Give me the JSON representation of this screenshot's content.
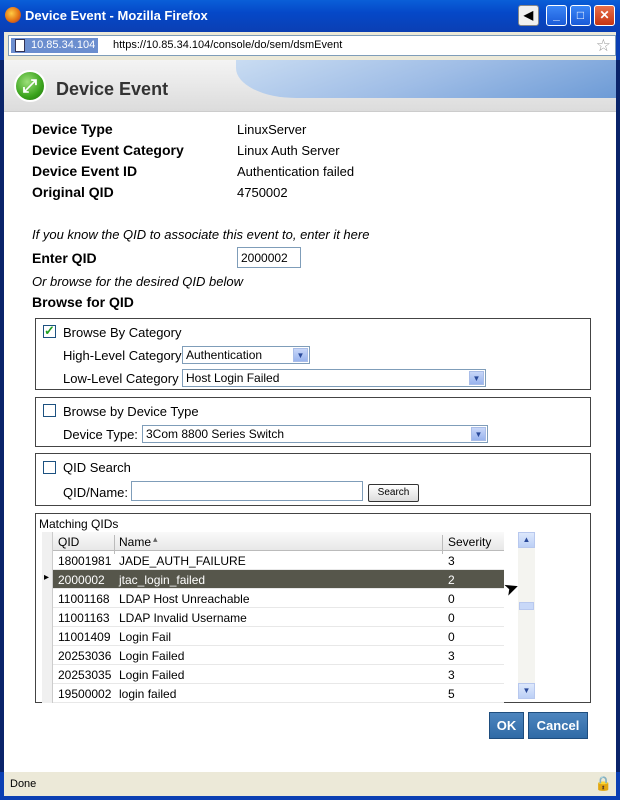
{
  "window": {
    "title": "Device Event - Mozilla Firefox",
    "buttons": {
      "back": "◀",
      "minimize": "_",
      "maximize": "□",
      "close": "✕"
    }
  },
  "urlbar": {
    "host": "10.85.34.104",
    "url": "https://10.85.34.104/console/do/sem/dsmEvent",
    "bookmark_icon": "star-icon"
  },
  "header": {
    "title": "Device Event",
    "icon": "event-map-icon"
  },
  "details": [
    {
      "label": "Device Type",
      "value": "LinuxServer"
    },
    {
      "label": "Device Event Category",
      "value": "Linux Auth Server"
    },
    {
      "label": "Device Event ID",
      "value": "Authentication failed"
    },
    {
      "label": "Original QID",
      "value": "4750002"
    }
  ],
  "qid_entry": {
    "hint": "If you know the QID to associate this event to, enter it here",
    "label": "Enter QID",
    "value": "2000002",
    "browse_hint": "Or browse for the desired QID below",
    "browse_title": "Browse for QID"
  },
  "category_box": {
    "label": "Browse By Category",
    "checked": true,
    "high_label": "High-Level Category",
    "high_value": "Authentication",
    "low_label": "Low-Level Category",
    "low_value": "Host Login Failed"
  },
  "device_box": {
    "label": "Browse by Device Type",
    "checked": false,
    "type_label": "Device Type:",
    "type_value": "3Com 8800 Series Switch"
  },
  "search_box": {
    "label": "QID Search",
    "checked": false,
    "name_label": "QID/Name:",
    "name_value": "",
    "search_button": "Search"
  },
  "matching": {
    "title": "Matching QIDs",
    "columns": {
      "qid": "QID",
      "name": "Name",
      "severity": "Severity"
    },
    "sort_indicator": "▴",
    "rows": [
      {
        "qid": "18001981",
        "name": "JADE_AUTH_FAILURE",
        "severity": "3"
      },
      {
        "qid": "2000002",
        "name": "jtac_login_failed",
        "severity": "2"
      },
      {
        "qid": "11001168",
        "name": "LDAP Host Unreachable",
        "severity": "0"
      },
      {
        "qid": "11001163",
        "name": "LDAP Invalid Username",
        "severity": "0"
      },
      {
        "qid": "11001409",
        "name": "Login Fail",
        "severity": "0"
      },
      {
        "qid": "20253036",
        "name": "Login Failed",
        "severity": "3"
      },
      {
        "qid": "20253035",
        "name": "Login Failed",
        "severity": "3"
      },
      {
        "qid": "19500002",
        "name": "login failed",
        "severity": "5"
      }
    ],
    "selected_index": 1
  },
  "actions": {
    "ok": "OK",
    "cancel": "Cancel"
  },
  "statusbar": {
    "text": "Done",
    "lock_icon": "lock-icon"
  }
}
